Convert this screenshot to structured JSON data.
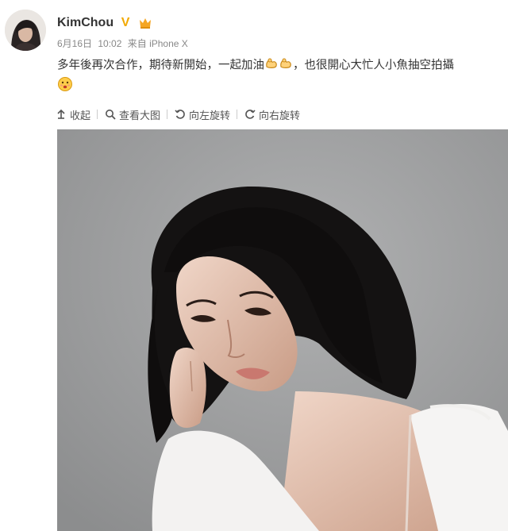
{
  "post": {
    "author": {
      "name": "KimChou",
      "verified_badge": "V"
    },
    "meta": {
      "date": "6月16日",
      "time": "10:02",
      "source": "来自 iPhone X"
    },
    "text": "多年後再次合作，期待新開始，一起加油",
    "text_after_emoji": "，也很開心大忙人小魚抽空拍攝",
    "emojis": [
      "flex-arm-emoji",
      "flex-arm-emoji",
      "face-emoji"
    ],
    "toolbar": {
      "collapse": "收起",
      "view_large": "查看大图",
      "rotate_left": "向左旋转",
      "rotate_right": "向右旋转"
    }
  },
  "colors": {
    "verified": "#f2a900",
    "text": "#333333",
    "meta": "#888888",
    "photo_bg": "#9d9e9f"
  }
}
